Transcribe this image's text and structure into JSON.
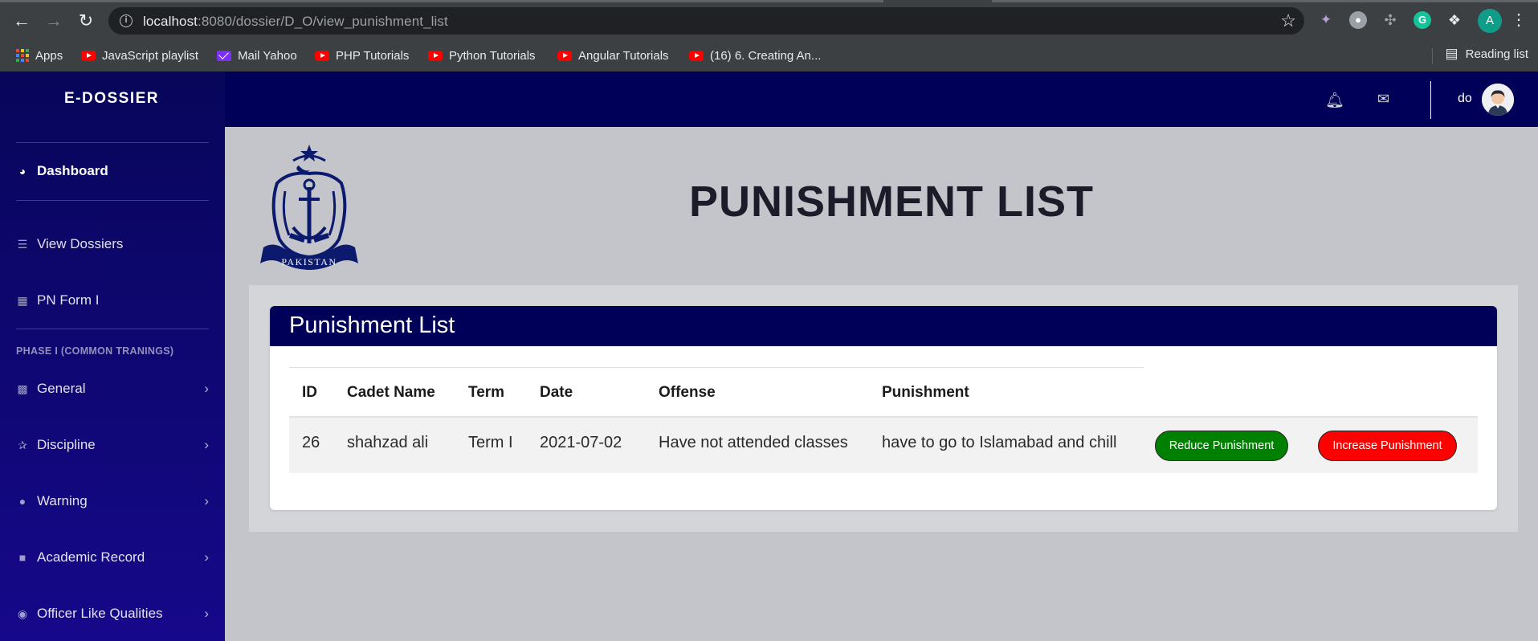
{
  "browser": {
    "url_host": "localhost",
    "url_rest": ":8080/dossier/D_O/view_punishment_list",
    "profile_initial": "A",
    "bookmarks": [
      {
        "label": "Apps",
        "icon": "apps-grid-icon"
      },
      {
        "label": "JavaScript playlist",
        "icon": "youtube-icon"
      },
      {
        "label": "Mail Yahoo",
        "icon": "yahoo-mail-icon"
      },
      {
        "label": "PHP Tutorials",
        "icon": "youtube-icon"
      },
      {
        "label": "Python Tutorials",
        "icon": "youtube-icon"
      },
      {
        "label": "Angular Tutorials",
        "icon": "youtube-icon"
      },
      {
        "label": "(16) 6. Creating An...",
        "icon": "youtube-icon"
      }
    ],
    "reading_list_label": "Reading list"
  },
  "sidebar": {
    "brand": "E-DOSSIER",
    "dashboard": "Dashboard",
    "view_dossiers": "View Dossiers",
    "pn_form": "PN Form I",
    "section_heading": "PHASE I (COMMON TRANINGS)",
    "general": "General",
    "discipline": "Discipline",
    "warning": "Warning",
    "academic_record": "Academic Record",
    "officer_qualities": "Officer Like Qualities"
  },
  "topbar": {
    "username": "do"
  },
  "page": {
    "title": "PUNISHMENT LIST",
    "card_title": "Punishment List"
  },
  "table": {
    "headers": {
      "id": "ID",
      "cadet_name": "Cadet Name",
      "term": "Term",
      "date": "Date",
      "offense": "Offense",
      "punishment": "Punishment"
    },
    "rows": [
      {
        "id": "26",
        "cadet_name": "shahzad ali",
        "term": "Term I",
        "date": "2021-07-02",
        "offense": "Have not attended classes",
        "punishment": "have to go to Islamabad and chill",
        "reduce_label": "Reduce Punishment",
        "increase_label": "Increase Punishment"
      }
    ]
  },
  "colors": {
    "navy": "#000058",
    "reduce_button": "#008000",
    "increase_button": "#ff0000"
  }
}
